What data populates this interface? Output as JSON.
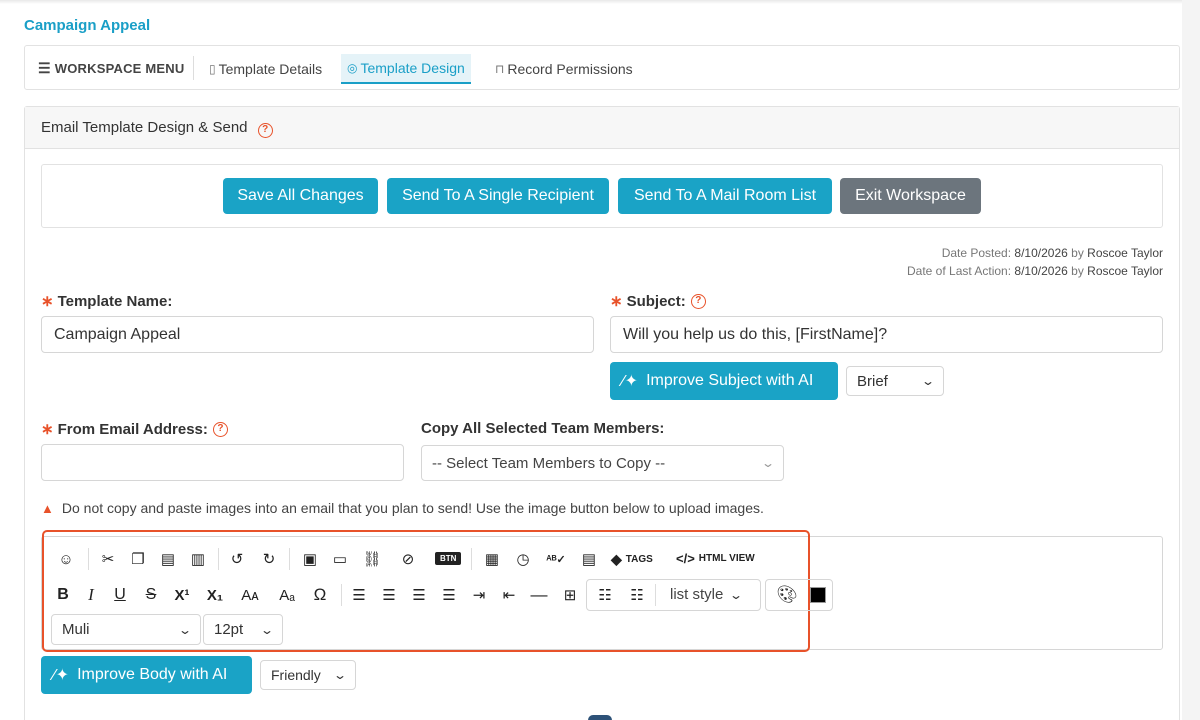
{
  "page": {
    "title": "Campaign Appeal"
  },
  "workspace": {
    "menu_label": "WORKSPACE MENU",
    "tabs": [
      {
        "label": "Template Details",
        "icon": "clipboard-icon"
      },
      {
        "label": "Template Design",
        "icon": "palette-icon",
        "active": true
      },
      {
        "label": "Record Permissions",
        "icon": "lock-icon"
      }
    ]
  },
  "panel": {
    "title": "Email Template Design & Send"
  },
  "actions": {
    "save": "Save All Changes",
    "single": "Send To A Single Recipient",
    "mailroom": "Send To A Mail Room List",
    "exit": "Exit Workspace"
  },
  "meta": {
    "posted_label": "Date Posted:",
    "posted_date": "8/10/2026",
    "posted_by_word": "by",
    "posted_by": "Roscoe Taylor",
    "last_label": "Date of Last Action:",
    "last_date": "8/10/2026",
    "last_by_word": "by",
    "last_by": "Roscoe Taylor"
  },
  "form": {
    "template_name_label": "Template Name:",
    "template_name_value": "Campaign Appeal",
    "subject_label": "Subject:",
    "subject_value": "Will you help us do this, [FirstName]?",
    "improve_subject": "Improve Subject with AI",
    "subject_tone": "Brief",
    "from_label": "From Email Address:",
    "from_value": "",
    "copy_label": "Copy All Selected Team Members:",
    "copy_placeholder": "-- Select Team Members to Copy --"
  },
  "warning": "Do not copy and paste images into an email that you plan to send! Use the image button below to upload images.",
  "toolbar": {
    "btn_label": "BTN",
    "tags_label": "TAGS",
    "html_view_label": "HTML VIEW",
    "list_style": "list style",
    "font_family": "Muli",
    "font_size": "12pt",
    "text_color": "#000000"
  },
  "body_ai": {
    "label": "Improve Body with AI",
    "tone": "Friendly"
  },
  "colors": {
    "accent": "#1aa3c6",
    "danger": "#e8522a",
    "gray_button": "#6c757d"
  }
}
